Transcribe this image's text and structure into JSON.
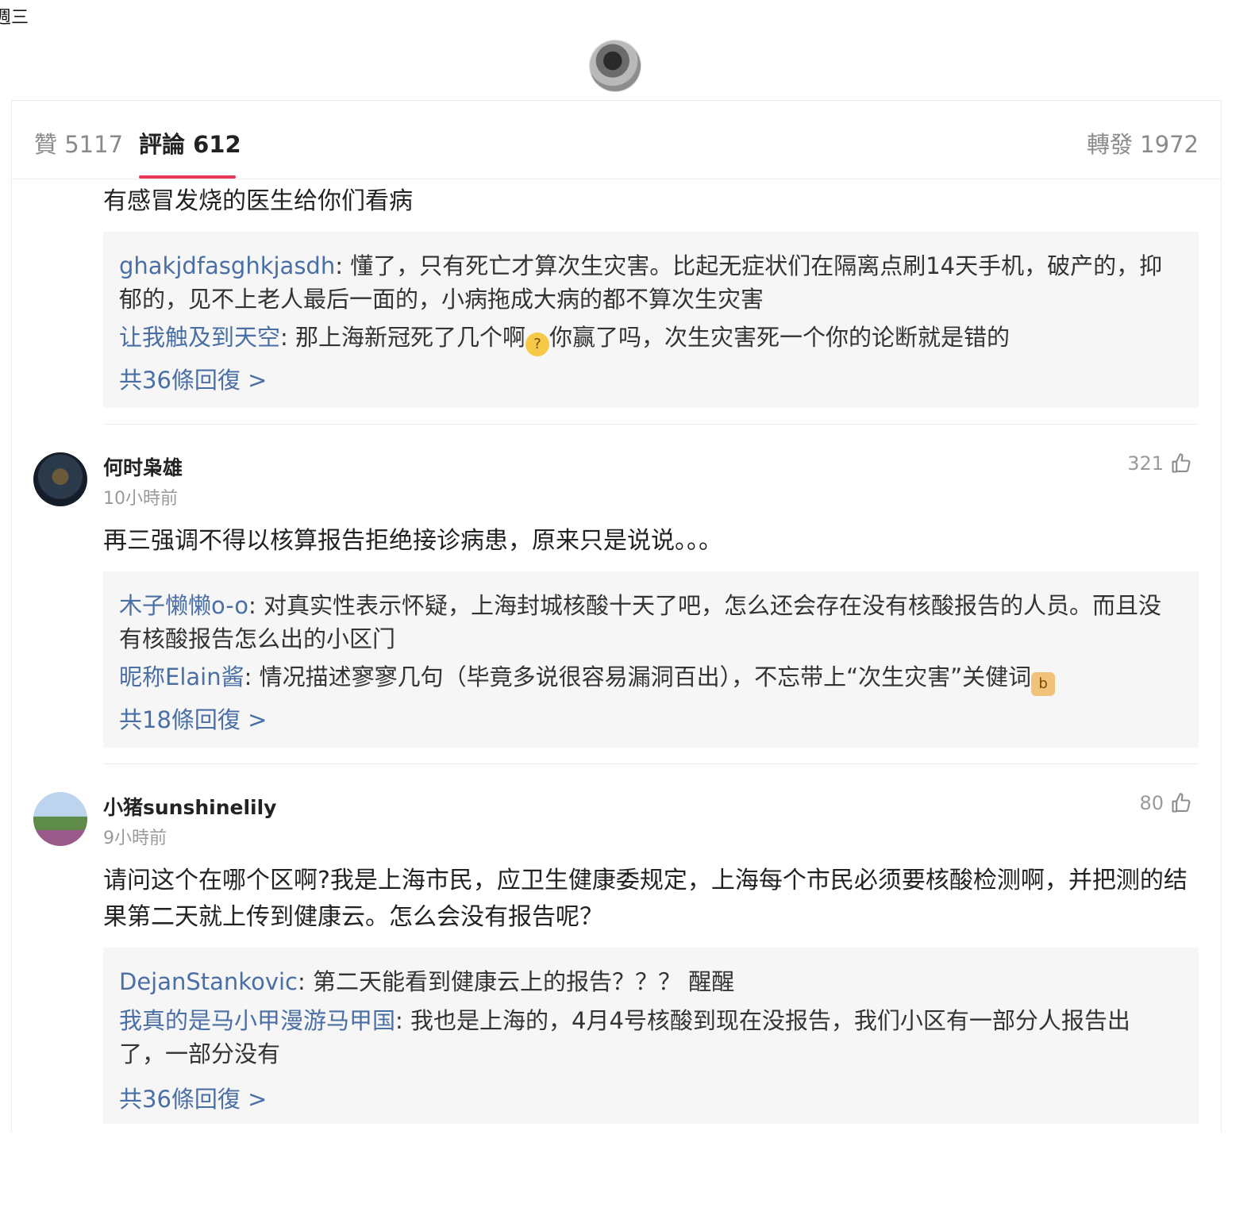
{
  "status": {
    "weekday": "週三"
  },
  "tabs": {
    "likes": "贊 5117",
    "comments": "評論 612",
    "reposts": "轉發 1972"
  },
  "comments": [
    {
      "text": "有感冒发烧的医生给你们看病",
      "replies": [
        {
          "user": "ghakjdfasghkjasdh",
          "text": ": 懂了，只有死亡才算次生灾害。比起无症状们在隔离点刷14天手机，破产的，抑郁的，见不上老人最后一面的，小病拖成大病的都不算次生灾害"
        },
        {
          "user": "让我触及到天空",
          "text_a": ": 那上海新冠死了几个啊",
          "text_b": "你赢了吗，次生灾害死一个你的论断就是错的"
        }
      ],
      "more": "共36條回復 >"
    },
    {
      "user": "何时枭雄",
      "time": "10小時前",
      "likes": "321",
      "text": "再三强调不得以核算报告拒绝接诊病患，原来只是说说。。。",
      "replies": [
        {
          "user": "木子懒懒o-o",
          "text": ": 对真实性表示怀疑，上海封城核酸十天了吧，怎么还会存在没有核酸报告的人员。而且没有核酸报告怎么出的小区门"
        },
        {
          "user": "昵称Elain酱",
          "text": ": 情况描述寥寥几句（毕竟多说很容易漏洞百出），不忘带上“次生灾害”关健词"
        }
      ],
      "more": "共18條回復 >"
    },
    {
      "user": "小猪sunshinelily",
      "time": "9小時前",
      "likes": "80",
      "text": "请问这个在哪个区啊?我是上海市民，应卫生健康委规定，上海每个市民必须要核酸检测啊，并把测的结果第二天就上传到健康云。怎么会没有报告呢？",
      "replies": [
        {
          "user": "DejanStankovic",
          "text": ": 第二天能看到健康云上的报告？？？ 醒醒"
        },
        {
          "user": "我真的是马小甲漫游马甲国",
          "text": ": 我也是上海的，4月4号核酸到现在没报告，我们小区有一部分人报告出了，一部分没有"
        }
      ],
      "more": "共36條回復 >"
    }
  ],
  "icons": {
    "thumb": "thumbs-up-icon",
    "emoji_think": "thinking-face-emoji",
    "emoji_thumb": "thumbs-up-emoji"
  }
}
